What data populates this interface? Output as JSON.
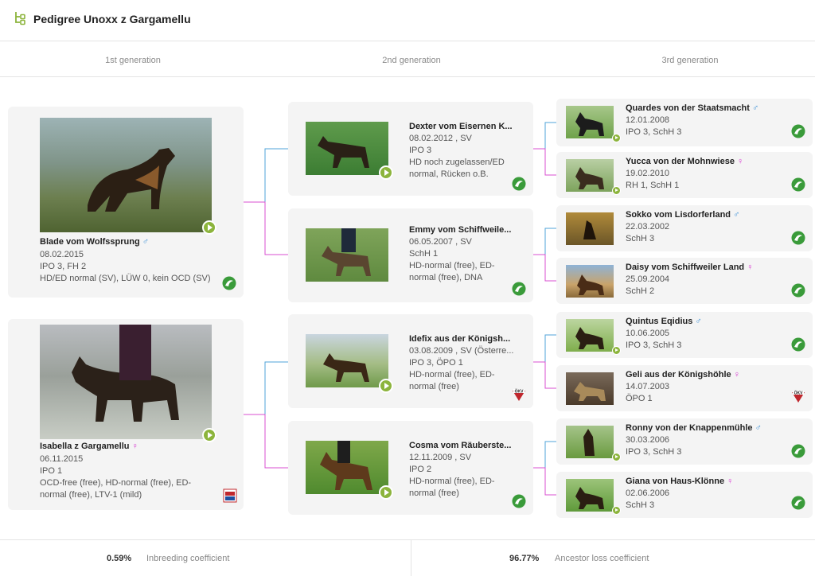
{
  "header": {
    "title": "Pedigree Unoxx z Gargamellu",
    "icon": "pedigree-tree-icon"
  },
  "generations": [
    "1st generation",
    "2nd generation",
    "3rd generation"
  ],
  "colors": {
    "accent": "#8cb43c",
    "male": "#3a8fd6",
    "female": "#d63ad0",
    "card_bg": "#f4f4f4"
  },
  "gen1": [
    {
      "name": "Blade vom Wolfssprung",
      "sex": "♂",
      "date": "08.02.2015",
      "titles": "IPO 3, FH 2",
      "health": "HD/ED normal (SV), LÜW 0, kein OCD (SV)",
      "badge": "sv-logo"
    },
    {
      "name": "Isabella z Gargamellu",
      "sex": "♀",
      "date": "06.11.2015",
      "titles": "IPO 1",
      "health": "OCD-free (free), HD-normal (free), ED-normal (free), LTV-1 (mild)",
      "badge": "cmku-logo"
    }
  ],
  "gen2": [
    {
      "name": "Dexter vom Eisernen K...",
      "sex": "",
      "date": "08.02.2012 , SV",
      "titles": "IPO 3",
      "health": "HD noch zugelassen/ED normal, Rücken o.B.",
      "badge": "sv-logo"
    },
    {
      "name": "Emmy vom Schiffweile...",
      "sex": "",
      "date": "06.05.2007 , SV",
      "titles": "SchH 1",
      "health": "HD-normal (free), ED-normal (free), DNA checked (checked)",
      "badge": "sv-logo"
    },
    {
      "name": "Idefix aus der Königsh...",
      "sex": "",
      "date": "03.08.2009 , SV (Österre...",
      "titles": "IPO 3, ÖPO 1",
      "health": "HD-normal (free), ED-normal (free)",
      "badge": "okv-logo"
    },
    {
      "name": "Cosma vom Räuberste...",
      "sex": "",
      "date": "12.11.2009 , SV",
      "titles": "IPO 2",
      "health": "HD-normal (free), ED-normal (free)",
      "badge": "sv-logo"
    }
  ],
  "gen3": [
    {
      "name": "Quardes von der Staatsmacht",
      "sex": "♂",
      "date": "12.01.2008",
      "titles": "IPO 3, SchH 3",
      "badge": "sv-logo"
    },
    {
      "name": "Yucca von der Mohnwiese",
      "sex": "♀",
      "date": "19.02.2010",
      "titles": "RH 1, SchH 1",
      "badge": "sv-logo"
    },
    {
      "name": "Sokko vom Lisdorferland",
      "sex": "♂",
      "date": "22.03.2002",
      "titles": "SchH 3",
      "badge": "sv-logo"
    },
    {
      "name": "Daisy vom Schiffweiler Land",
      "sex": "♀",
      "date": "25.09.2004",
      "titles": "SchH 2",
      "badge": "sv-logo"
    },
    {
      "name": "Quintus Eqidius",
      "sex": "♂",
      "date": "10.06.2005",
      "titles": "IPO 3, SchH 3",
      "badge": "sv-logo"
    },
    {
      "name": "Geli aus der Königshöhle",
      "sex": "♀",
      "date": "14.07.2003",
      "titles": "ÖPO 1",
      "badge": "okv-logo"
    },
    {
      "name": "Ronny von der Knappenmühle",
      "sex": "♂",
      "date": "30.03.2006",
      "titles": "IPO 3, SchH 3",
      "badge": "sv-logo"
    },
    {
      "name": "Giana von Haus-Klönne",
      "sex": "♀",
      "date": "02.06.2006",
      "titles": "SchH 3",
      "badge": "sv-logo"
    }
  ],
  "footer": {
    "inbreeding_value": "0.59%",
    "inbreeding_label": "Inbreeding coefficient",
    "ancestor_value": "96.77%",
    "ancestor_label": "Ancestor loss coefficient"
  }
}
